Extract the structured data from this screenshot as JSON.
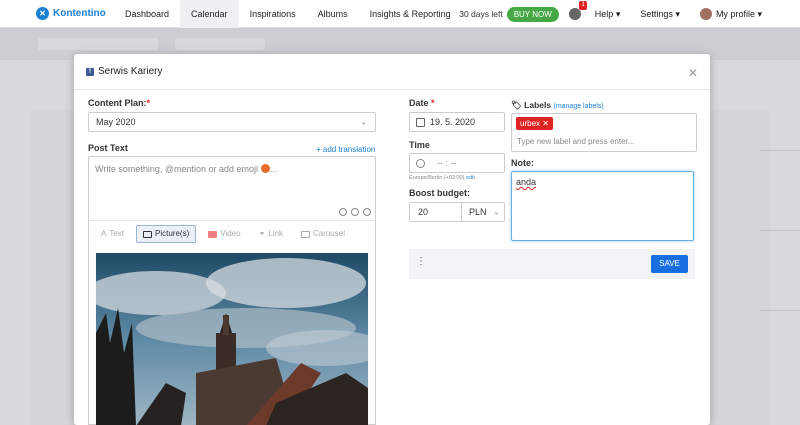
{
  "nav": {
    "brand": "Kontentino",
    "items": [
      "Dashboard",
      "Calendar",
      "Inspirations",
      "Albums",
      "Insights & Reporting"
    ],
    "trial_text": "30 days left",
    "buy_label": "BUY NOW",
    "notification_count": "1",
    "help_label": "Help",
    "settings_label": "Settings",
    "profile_label": "My profile"
  },
  "modal": {
    "title": "Serwis Kariery",
    "content_plan_label": "Content Plan:",
    "content_plan_value": "May 2020",
    "post_text_label": "Post Text",
    "add_translation": "+ add translation",
    "post_placeholder": "Write something, @mention or add emoji",
    "tabs": [
      "Text",
      "Picture(s)",
      "Video",
      "Link",
      "Carousel"
    ],
    "date_label": "Date",
    "date_value": "19. 5. 2020",
    "time_label": "Time",
    "time_value": "-- : --",
    "timezone_text": "Europe/Berlin (+02:00)",
    "timezone_edit": "edit",
    "boost_label": "Boost budget:",
    "boost_value": "20",
    "currency": "PLN",
    "labels_label": "Labels",
    "manage_labels": "(manage labels)",
    "label_tag": "urbex",
    "label_placeholder": "Type new label and press enter...",
    "note_label": "Note:",
    "note_value": "anda",
    "save_label": "SAVE"
  },
  "colors": {
    "accent": "#1b7fd4",
    "buy_green": "#45a845",
    "save_blue": "#1a6fe0",
    "tag_red": "#e02424"
  }
}
